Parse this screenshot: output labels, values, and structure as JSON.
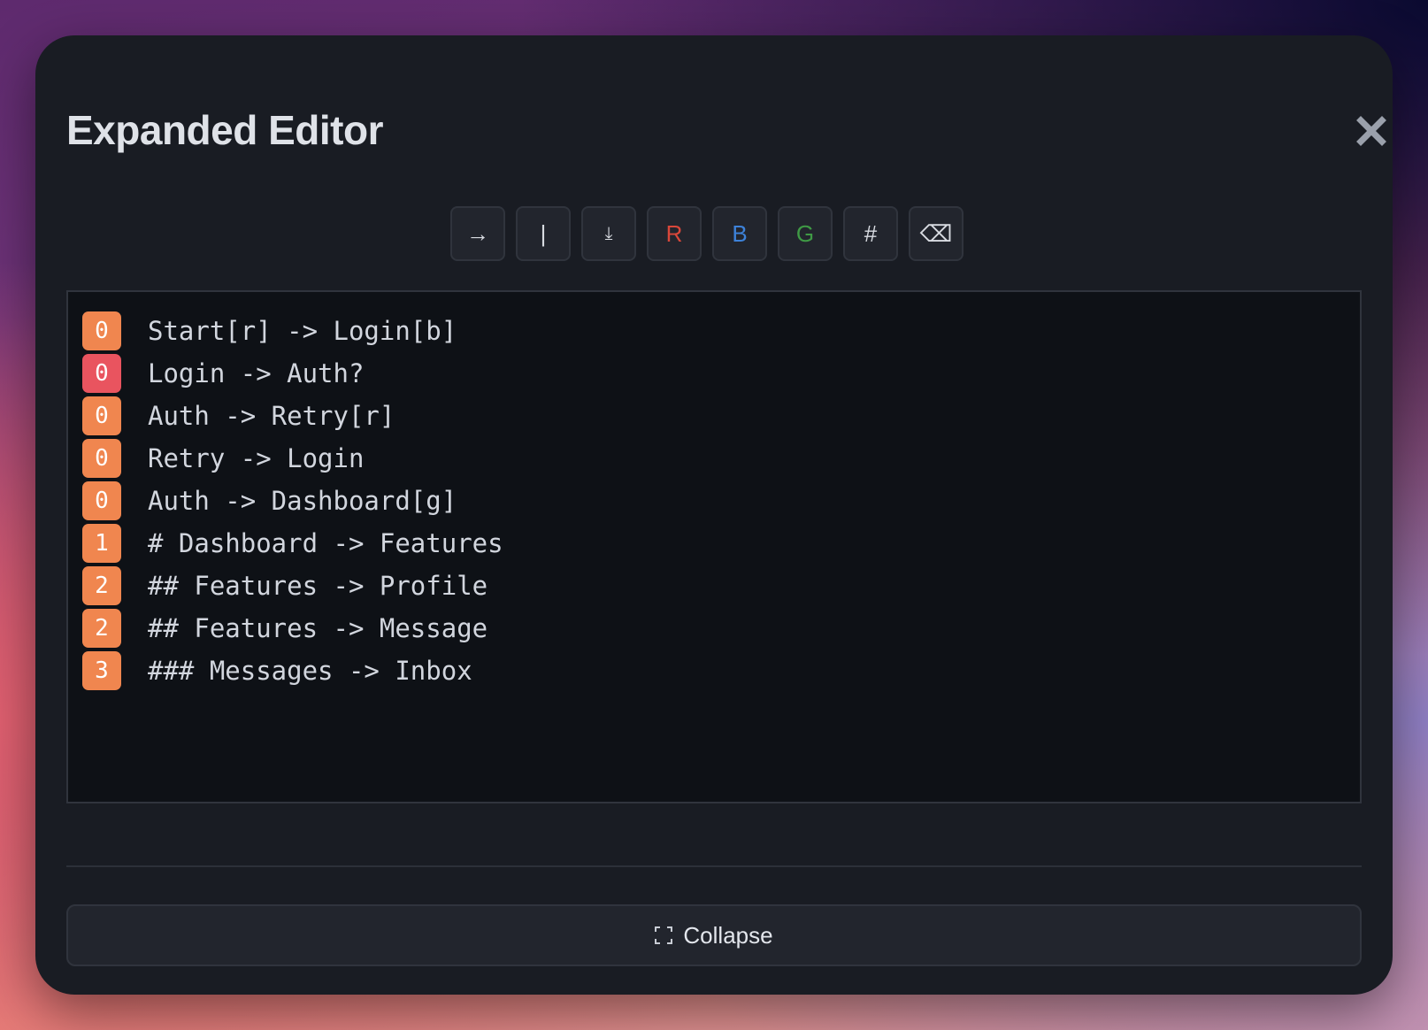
{
  "modal": {
    "title": "Expanded Editor",
    "close_icon": "close-icon"
  },
  "toolbar": {
    "buttons": [
      {
        "name": "arrow-button",
        "label": "→",
        "color": "#d8dbe1"
      },
      {
        "name": "pipe-button",
        "label": "|",
        "color": "#d8dbe1"
      },
      {
        "name": "down-arrow-button",
        "label": "⤓",
        "color": "#d8dbe1"
      },
      {
        "name": "red-button",
        "label": "R",
        "color": "#d9473a"
      },
      {
        "name": "blue-button",
        "label": "B",
        "color": "#3d82d9"
      },
      {
        "name": "green-button",
        "label": "G",
        "color": "#3f9a45"
      },
      {
        "name": "heading-button",
        "label": "#",
        "color": "#d8dbe1"
      },
      {
        "name": "backspace-button",
        "label": "⌫",
        "color": "#d8dbe1"
      }
    ]
  },
  "editor": {
    "lines": [
      {
        "level": "0",
        "text": "Start[r] -> Login[b]",
        "badge_color": "#f0864f"
      },
      {
        "level": "0",
        "text": "Login -> Auth?",
        "badge_color": "#e9545f"
      },
      {
        "level": "0",
        "text": "Auth -> Retry[r]",
        "badge_color": "#f0864f"
      },
      {
        "level": "0",
        "text": "Retry -> Login",
        "badge_color": "#f0864f"
      },
      {
        "level": "0",
        "text": "Auth -> Dashboard[g]",
        "badge_color": "#f0864f"
      },
      {
        "level": "1",
        "text": "# Dashboard -> Features",
        "badge_color": "#f0864f"
      },
      {
        "level": "2",
        "text": "## Features -> Profile",
        "badge_color": "#f0864f"
      },
      {
        "level": "2",
        "text": "## Features -> Message",
        "badge_color": "#f0864f"
      },
      {
        "level": "3",
        "text": "### Messages -> Inbox",
        "badge_color": "#f0864f"
      }
    ]
  },
  "footer": {
    "collapse_label": "Collapse",
    "collapse_icon": "collapse-icon"
  }
}
